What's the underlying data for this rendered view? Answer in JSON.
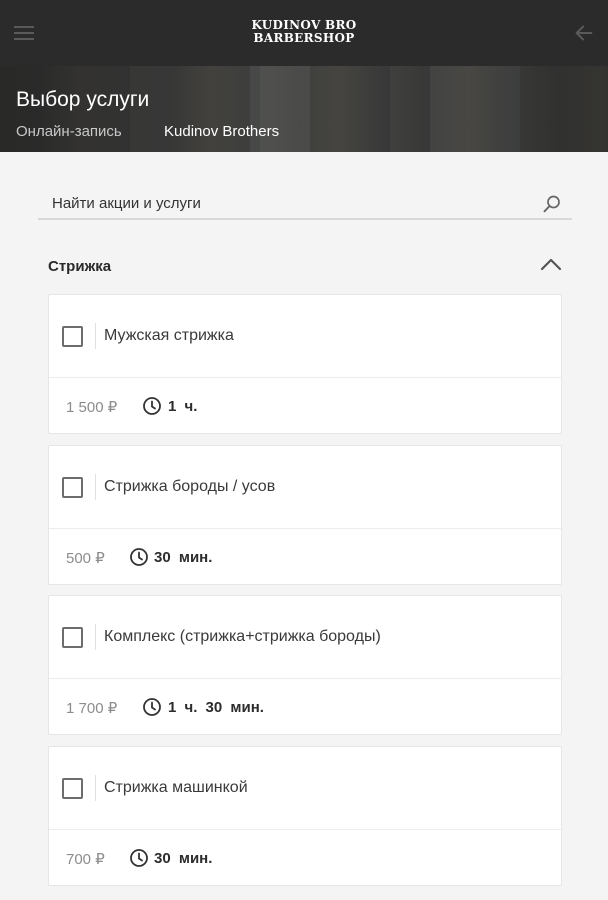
{
  "header": {
    "logo_line1": "KUDINOV BRO",
    "logo_line2": "BARBERSHOP",
    "menu_icon": "hamburger-menu-icon",
    "back_icon": "arrow-left-icon"
  },
  "hero": {
    "title": "Выбор услуги",
    "breadcrumb_step": "Онлайн-запись",
    "location": "Kudinov Brothers"
  },
  "search": {
    "placeholder": "Найти акции и услуги",
    "icon": "search-icon"
  },
  "section": {
    "title": "Стрижка",
    "collapse_icon": "chevron-up-icon"
  },
  "services": [
    {
      "name": "Мужская стрижка",
      "price": "1 500 ₽",
      "duration": "1 ч."
    },
    {
      "name": "Стрижка бороды / усов",
      "price": "500 ₽",
      "duration": "30 мин."
    },
    {
      "name": "Комплекс (стрижка+стрижка бороды)",
      "price": "1 700 ₽",
      "duration": "1 ч. 30 мин."
    },
    {
      "name": "Стрижка машинкой",
      "price": "700 ₽",
      "duration": "30 мин."
    }
  ],
  "colors": {
    "header_bg": "#2b2b2b",
    "page_bg": "#f4f4f4",
    "card_bg": "#ffffff",
    "price_text": "#8c8c8c"
  }
}
